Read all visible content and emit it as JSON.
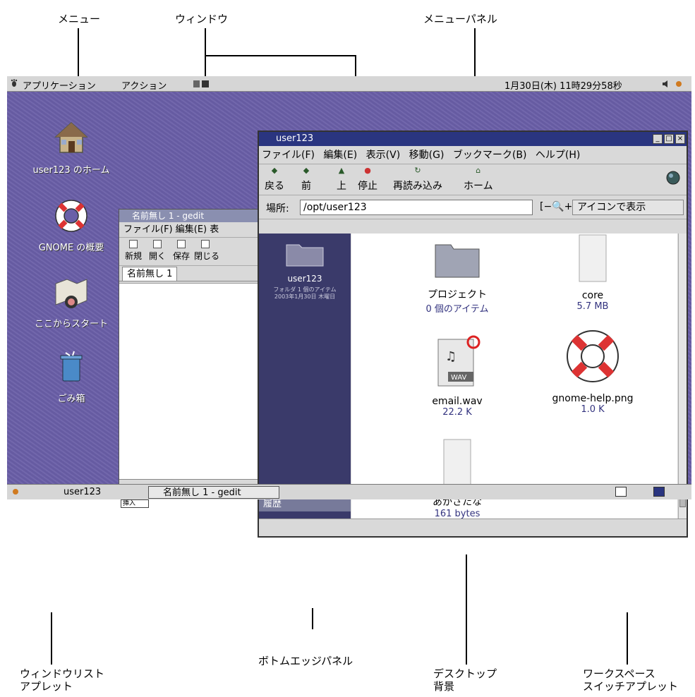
{
  "annotations": {
    "menu": "メニュー",
    "window": "ウィンドウ",
    "menu_panel": "メニューパネル",
    "window_list_applet": "ウィンドウリスト\nアプレット",
    "bottom_edge_panel": "ボトムエッジパネル",
    "desktop_background": "デスクトップ\n背景",
    "workspace_switcher": "ワークスペース\nスイッチアプレット"
  },
  "top_panel": {
    "applications": "アプリケーション",
    "actions": "アクション",
    "clock": "1月30日(木) 11時29分58秒"
  },
  "desktop_icons": [
    {
      "label": "user123 のホーム",
      "icon": "home-icon"
    },
    {
      "label": "GNOME の概要",
      "icon": "lifebuoy-icon"
    },
    {
      "label": "ここからスタート",
      "icon": "map-compass-icon"
    },
    {
      "label": "ごみ箱",
      "icon": "trash-icon"
    }
  ],
  "gedit": {
    "title": "名前無し 1 - gedit",
    "menu": "ファイル(F) 編集(E) 表",
    "tools": [
      "新規",
      "開く",
      "保存",
      "閉じる"
    ],
    "tab": "名前無し 1",
    "zoom": "挿入"
  },
  "nautilus": {
    "title": "user123",
    "menu": [
      "ファイル(F)",
      "編集(E)",
      "表示(V)",
      "移動(G)",
      "ブックマーク(B)",
      "ヘルプ(H)"
    ],
    "tools": [
      "戻る",
      "前",
      "上",
      "停止",
      "再読み込み",
      "ホーム"
    ],
    "location_label": "場所:",
    "location": "/opt/user123",
    "view_mode": "アイコンで表示",
    "side_folder": "user123",
    "side_info": "フォルダ 1 個のアイテム\n2003年1月30日 木曜日",
    "history_tab": "履歴",
    "files": [
      {
        "name": "プロジェクト",
        "detail": "0 個のアイテム",
        "icon": "folder-icon"
      },
      {
        "name": "core",
        "detail": "5.7 MB",
        "icon": "document-icon"
      },
      {
        "name": "email.wav",
        "detail": "22.2 K",
        "icon": "wav-icon"
      },
      {
        "name": "gnome-help.png",
        "detail": "1.0 K",
        "icon": "lifebuoy-icon"
      },
      {
        "name": "あかさたな",
        "detail": "161 bytes",
        "icon": "document-icon"
      }
    ]
  },
  "bottom_panel": {
    "task1": "user123",
    "task2": "名前無し 1 - gedit"
  },
  "colors": {
    "desktop": "#6a5fa8",
    "title_active": "#2a3580",
    "panel": "#d6d6d6"
  }
}
